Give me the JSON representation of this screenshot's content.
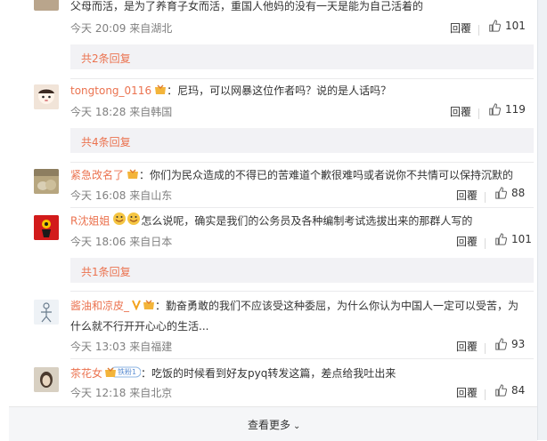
{
  "comments": [
    {
      "name": "",
      "text": "父母而活，是为了养育子女而活，重国人他妈的没有一天是能为自己活着的",
      "meta": "今天 20:09 来自湖北",
      "reply": "回覆",
      "likes": "101",
      "subreplies": "共2条回复"
    },
    {
      "name": "tongtong_0116",
      "text": "：尼玛，可以网暴这位作者吗？说的是人话吗？",
      "meta": "今天 18:28 来自韩国",
      "reply": "回覆",
      "likes": "119",
      "subreplies": "共4条回复"
    },
    {
      "name": "紧急改名了",
      "text": "：你们为民众造成的不得已的苦难道个歉很难吗或者说你不共情可以保持沉默的",
      "meta": "今天 16:08 来自山东",
      "reply": "回覆",
      "likes": "88"
    },
    {
      "name": "R沈姐姐",
      "text": "怎么说呢，确实是我们的公务员及各种编制考试选拔出来的那群人写的",
      "meta": "今天 18:06 来自日本",
      "reply": "回覆",
      "likes": "101",
      "subreplies": "共1条回复"
    },
    {
      "name": "酱油和凉皮_",
      "text": "：勤奋勇敢的我们不应该受这种委屈，为什么你认为中国人一定可以受苦，为",
      "text2": "什么就不行开开心心的生活...",
      "meta": "今天 13:03 来自福建",
      "reply": "回覆",
      "likes": "93"
    },
    {
      "name": "茶花女",
      "badge": "铁粉1",
      "text": "：吃饭的时候看到好友pyq转发这篇，差点给我吐出来",
      "meta": "今天 12:18 来自北京",
      "reply": "回覆",
      "likes": "84"
    }
  ],
  "load_more": "查看更多",
  "colors": {
    "accent": "#eb7350",
    "subbox_bg": "#f2f2f5"
  }
}
